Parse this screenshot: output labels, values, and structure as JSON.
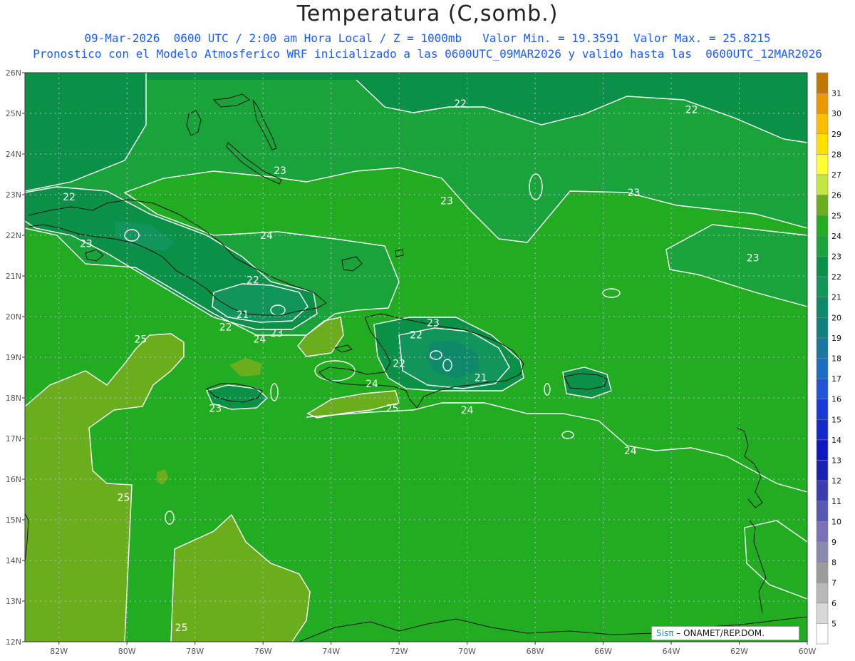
{
  "header": {
    "title": "Temperatura (C,somb.)",
    "line1": "09-Mar-2026  0600 UTC / 2:00 am Hora Local / Z = 1000mb   Valor Min. = 19.3591  Valor Max. = 25.8215",
    "line2": "Pronostico con el Modelo Atmosferico WRF inicializado a las 0600UTC_09MAR2026 y valido hasta las  0600UTC_12MAR2026"
  },
  "map": {
    "lon_range": [
      -83,
      -60
    ],
    "lat_range": [
      12,
      26
    ],
    "lon_ticks": [
      {
        "value": -82,
        "label": "82W"
      },
      {
        "value": -80,
        "label": "80W"
      },
      {
        "value": -78,
        "label": "78W"
      },
      {
        "value": -76,
        "label": "76W"
      },
      {
        "value": -74,
        "label": "74W"
      },
      {
        "value": -72,
        "label": "72W"
      },
      {
        "value": -70,
        "label": "70W"
      },
      {
        "value": -68,
        "label": "68W"
      },
      {
        "value": -66,
        "label": "66W"
      },
      {
        "value": -64,
        "label": "64W"
      },
      {
        "value": -62,
        "label": "62W"
      },
      {
        "value": -60,
        "label": "60W"
      }
    ],
    "lat_ticks": [
      {
        "value": 26,
        "label": "26N"
      },
      {
        "value": 25,
        "label": "25N"
      },
      {
        "value": 24,
        "label": "24N"
      },
      {
        "value": 23,
        "label": "23N"
      },
      {
        "value": 22,
        "label": "22N"
      },
      {
        "value": 21,
        "label": "21N"
      },
      {
        "value": 20,
        "label": "20N"
      },
      {
        "value": 19,
        "label": "19N"
      },
      {
        "value": 18,
        "label": "18N"
      },
      {
        "value": 17,
        "label": "17N"
      },
      {
        "value": 16,
        "label": "16N"
      },
      {
        "value": 15,
        "label": "15N"
      },
      {
        "value": 14,
        "label": "14N"
      },
      {
        "value": 13,
        "label": "13N"
      },
      {
        "value": 12,
        "label": "12N"
      }
    ],
    "colors": {
      "t20": "#0e8a4e",
      "t21": "#12955a",
      "t22": "#0b9147",
      "t23": "#1aa33a",
      "t24": "#21ac22",
      "t25": "#6aae1e",
      "t26": "#6fb312",
      "grid": "#b9b9d6",
      "coast": "#111111"
    },
    "contour_labels": [
      {
        "lon": -70.2,
        "lat": 25.25,
        "text": "22"
      },
      {
        "lon": -63.4,
        "lat": 25.1,
        "text": "22"
      },
      {
        "lon": -81.7,
        "lat": 22.95,
        "text": "22"
      },
      {
        "lon": -81.2,
        "lat": 21.8,
        "text": "23"
      },
      {
        "lon": -75.5,
        "lat": 23.6,
        "text": "23"
      },
      {
        "lon": -70.6,
        "lat": 22.85,
        "text": "23"
      },
      {
        "lon": -65.1,
        "lat": 23.05,
        "text": "23"
      },
      {
        "lon": -61.6,
        "lat": 21.45,
        "text": "23"
      },
      {
        "lon": -75.9,
        "lat": 22.0,
        "text": "24"
      },
      {
        "lon": -76.3,
        "lat": 20.9,
        "text": "22"
      },
      {
        "lon": -76.6,
        "lat": 20.05,
        "text": "21"
      },
      {
        "lon": -77.1,
        "lat": 19.75,
        "text": "22"
      },
      {
        "lon": -75.6,
        "lat": 19.6,
        "text": "23"
      },
      {
        "lon": -76.1,
        "lat": 19.45,
        "text": "24"
      },
      {
        "lon": -79.6,
        "lat": 19.45,
        "text": "25"
      },
      {
        "lon": -71.0,
        "lat": 19.85,
        "text": "23"
      },
      {
        "lon": -71.5,
        "lat": 19.55,
        "text": "22"
      },
      {
        "lon": -72.0,
        "lat": 18.85,
        "text": "22"
      },
      {
        "lon": -69.6,
        "lat": 18.5,
        "text": "21"
      },
      {
        "lon": -72.8,
        "lat": 18.35,
        "text": "24"
      },
      {
        "lon": -72.2,
        "lat": 17.75,
        "text": "25"
      },
      {
        "lon": -70.0,
        "lat": 17.7,
        "text": "24"
      },
      {
        "lon": -77.4,
        "lat": 17.75,
        "text": "23"
      },
      {
        "lon": -65.2,
        "lat": 16.7,
        "text": "24"
      },
      {
        "lon": -80.1,
        "lat": 15.55,
        "text": "25"
      },
      {
        "lon": -78.4,
        "lat": 12.35,
        "text": "25"
      }
    ]
  },
  "colorbar": {
    "levels": [
      {
        "label": "31",
        "color": "#c07800"
      },
      {
        "label": "30",
        "color": "#e89a00"
      },
      {
        "label": "29",
        "color": "#ffbf00"
      },
      {
        "label": "28",
        "color": "#ffe000"
      },
      {
        "label": "27",
        "color": "#ffff33"
      },
      {
        "label": "26",
        "color": "#c5e640"
      },
      {
        "label": "25",
        "color": "#6aae1e"
      },
      {
        "label": "24",
        "color": "#21ac22"
      },
      {
        "label": "23",
        "color": "#1aa33a"
      },
      {
        "label": "22",
        "color": "#0b9147"
      },
      {
        "label": "21",
        "color": "#12955a"
      },
      {
        "label": "20",
        "color": "#0e8a6a"
      },
      {
        "label": "19",
        "color": "#127f7f"
      },
      {
        "label": "18",
        "color": "#1878a0"
      },
      {
        "label": "17",
        "color": "#1c6cc0"
      },
      {
        "label": "16",
        "color": "#1f55d6"
      },
      {
        "label": "15",
        "color": "#1a3ad8"
      },
      {
        "label": "14",
        "color": "#1428cc"
      },
      {
        "label": "13",
        "color": "#0f18c0"
      },
      {
        "label": "12",
        "color": "#1c22b0"
      },
      {
        "label": "11",
        "color": "#3a3cb0"
      },
      {
        "label": "10",
        "color": "#5658b4"
      },
      {
        "label": "9",
        "color": "#7a72b8"
      },
      {
        "label": "8",
        "color": "#8a8ab0"
      },
      {
        "label": "7",
        "color": "#9c9c9c"
      },
      {
        "label": "6",
        "color": "#b8b8b8"
      },
      {
        "label": "5",
        "color": "#d8d8d8"
      },
      {
        "label": "",
        "color": "#ffffff"
      }
    ]
  },
  "credit": {
    "brand": "Sisπ",
    "org": "– ONAMET/REP.DOM."
  }
}
